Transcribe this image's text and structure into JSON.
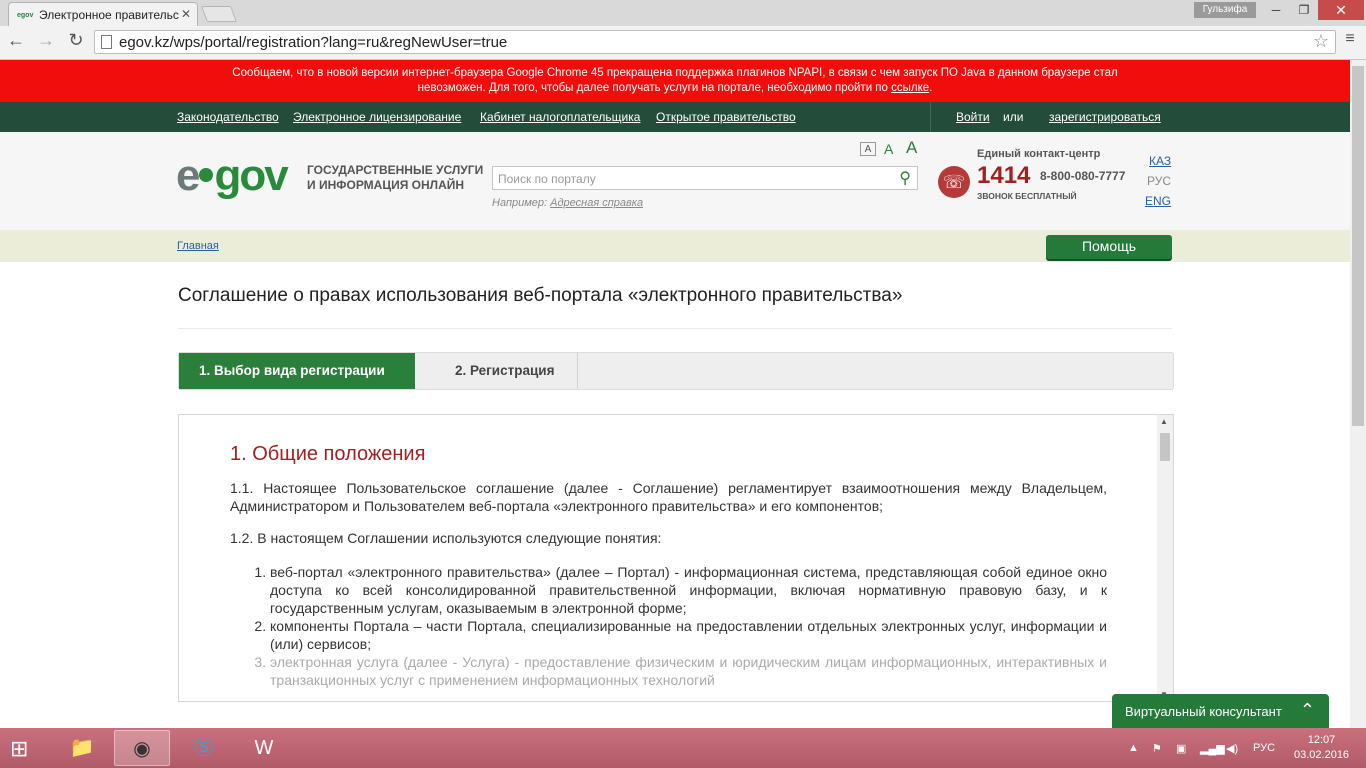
{
  "browser": {
    "tab_title": "Электронное правительс",
    "tab_favicon": "egov",
    "user_badge": "Гульзифа",
    "url": "egov.kz/wps/portal/registration?lang=ru&regNewUser=true"
  },
  "alert": {
    "line1": "Сообщаем, что в новой версии интернет-браузера Google Chrome 45 прекращена поддержка плагинов NPAPI, в связи с чем запуск ПО Java в данном браузере стал",
    "line2": "невозможен. Для того, чтобы далее получать услуги на портале, необходимо пройти по",
    "link": "ссылке",
    "line2_end": "."
  },
  "topnav": {
    "links": [
      "Законодательство",
      "Электронное лицензирование",
      "Кабинет налогоплательщика",
      "Открытое правительство"
    ],
    "login": "Войти",
    "or": "или",
    "register": "зарегистрироваться"
  },
  "header": {
    "logo_e": "e",
    "logo_gov": "gov",
    "tagline1": "ГОСУДАРСТВЕННЫЕ УСЛУГИ",
    "tagline2": "И ИНФОРМАЦИЯ ОНЛАЙН",
    "search_placeholder": "Поиск по порталу",
    "hint_label": "Например:",
    "hint_link": "Адресная справка",
    "font_sizes": [
      "A",
      "A",
      "A"
    ],
    "contact_label": "Единый контакт-центр",
    "contact_number": "1414",
    "contact_phone": "8-800-080-7777",
    "contact_free": "ЗВОНОК БЕСПЛАТНЫЙ",
    "languages": [
      "КАЗ",
      "РУС",
      "ENG"
    ]
  },
  "breadcrumb": "Главная",
  "help_button": "Помощь",
  "page_title": "Соглашение о правах использования веб-портала «электронного правительства»",
  "steps": [
    "1. Выбор вида регистрации",
    "2. Регистрация"
  ],
  "agreement": {
    "heading": "1. Общие положения",
    "p1": "1.1. Настоящее Пользовательское соглашение (далее - Соглашение) регламентирует взаимоотношения между Владельцем, Администратором и Пользователем веб-портала «электронного правительства» и его компонентов;",
    "p2": "1.2. В настоящем Соглашении используются следующие понятия:",
    "items": [
      "веб-портал «электронного правительства» (далее – Портал) - информационная система, представляющая собой единое окно доступа ко всей консолидированной правительственной информации, включая нормативную правовую базу, и к государственным услугам, оказываемым в электронной форме;",
      "компоненты Портала – части Портала, специализированные на предоставлении отдельных электронных услуг, информации и (или) сервисов;",
      "электронная услуга (далее - Услуга) - предоставление физическим и юридическим лицам информационных, интерактивных и транзакционных услуг с применением информационных технологий"
    ]
  },
  "consultant": "Виртуальный консультант",
  "taskbar": {
    "lang": "РУС",
    "time": "12:07",
    "date": "03.02.2016"
  }
}
